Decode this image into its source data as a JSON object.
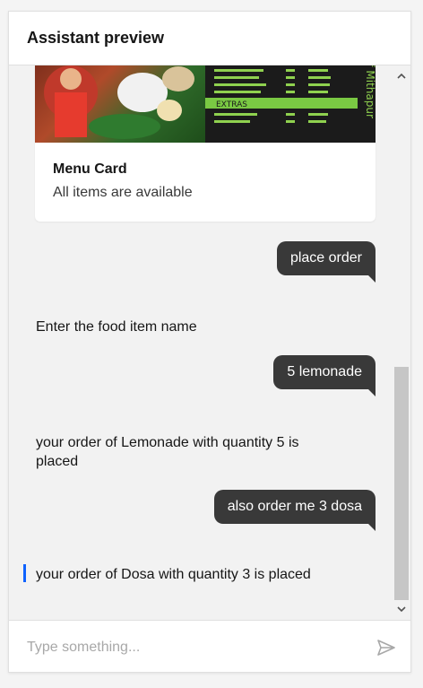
{
  "header": {
    "title": "Assistant preview"
  },
  "menu_card": {
    "title": "Menu Card",
    "subtitle": "All items are available",
    "image_text": {
      "extras": "EXTRAS",
      "side": "of Mithapur"
    }
  },
  "messages": [
    {
      "role": "user",
      "text": "place order"
    },
    {
      "role": "bot",
      "text": "Enter the food item name"
    },
    {
      "role": "user",
      "text": "5 lemonade"
    },
    {
      "role": "bot",
      "text": "your order of Lemonade with quantity 5 is placed"
    },
    {
      "role": "user",
      "text": "also order me 3 dosa"
    },
    {
      "role": "bot",
      "text": "your order of Dosa with quantity 3 is placed"
    }
  ],
  "composer": {
    "placeholder": "Type something..."
  },
  "colors": {
    "user_bubble": "#393939",
    "accent": "#0f62fe",
    "menu_green": "#7ac943"
  },
  "icons": {
    "send": "send-icon",
    "scroll_up": "chevron-up-icon",
    "scroll_down": "chevron-down-icon"
  }
}
